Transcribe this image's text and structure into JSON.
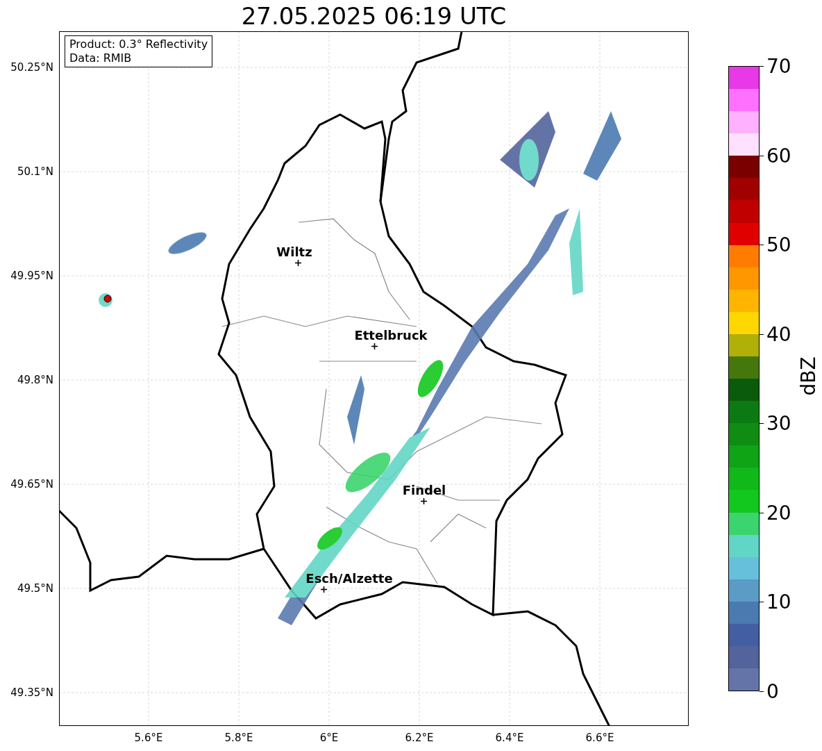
{
  "title": "27.05.2025 06:19 UTC",
  "info_box": [
    "Product: 0.3° Reflectivity",
    "Data: RMIB"
  ],
  "map": {
    "y_ticks": [
      "50.25°N",
      "50.1°N",
      "49.95°N",
      "49.8°N",
      "49.65°N",
      "49.5°N",
      "49.35°N"
    ],
    "x_ticks": [
      "5.6°E",
      "5.8°E",
      "6°E",
      "6.2°E",
      "6.4°E",
      "6.6°E"
    ],
    "places": [
      "Wiltz",
      "Ettelbruck",
      "Findel",
      "Esch/Alzette"
    ]
  },
  "colorbar": {
    "label": "dBZ",
    "ticks": [
      "70",
      "60",
      "50",
      "40",
      "30",
      "20",
      "10",
      "0"
    ],
    "bins": [
      {
        "color": "#e838e8"
      },
      {
        "color": "#ff70ff"
      },
      {
        "color": "#ffb0ff"
      },
      {
        "color": "#ffe0ff"
      },
      {
        "color": "#7a0000"
      },
      {
        "color": "#a00000"
      },
      {
        "color": "#c00000"
      },
      {
        "color": "#e00000"
      },
      {
        "color": "#ff7c00"
      },
      {
        "color": "#ff9800"
      },
      {
        "color": "#ffb400"
      },
      {
        "color": "#ffd700"
      },
      {
        "color": "#b0b008"
      },
      {
        "color": "#45780c"
      },
      {
        "color": "#0b5b0c"
      },
      {
        "color": "#0b7a12"
      },
      {
        "color": "#0f8c14"
      },
      {
        "color": "#0fa316"
      },
      {
        "color": "#10b81a"
      },
      {
        "color": "#12c81e"
      },
      {
        "color": "#3cd46e"
      },
      {
        "color": "#62d6c6"
      },
      {
        "color": "#66c0dc"
      },
      {
        "color": "#5a9cc6"
      },
      {
        "color": "#4a7ab0"
      },
      {
        "color": "#435ea2"
      },
      {
        "color": "#53649c"
      },
      {
        "color": "#6474a8"
      }
    ]
  }
}
